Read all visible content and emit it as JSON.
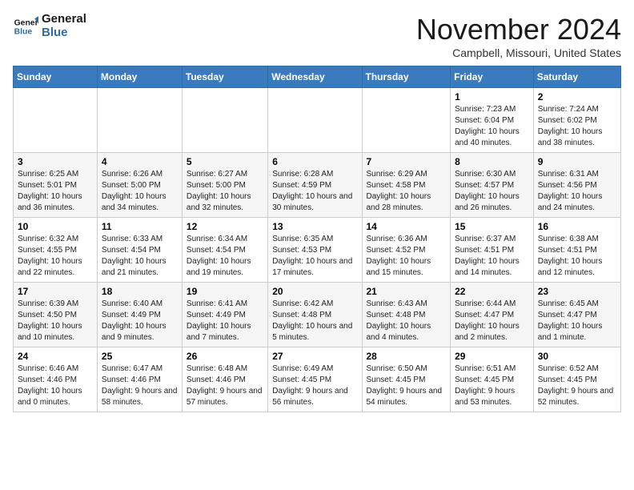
{
  "logo": {
    "line1": "General",
    "line2": "Blue"
  },
  "title": "November 2024",
  "location": "Campbell, Missouri, United States",
  "days_header": [
    "Sunday",
    "Monday",
    "Tuesday",
    "Wednesday",
    "Thursday",
    "Friday",
    "Saturday"
  ],
  "weeks": [
    [
      {
        "day": "",
        "info": ""
      },
      {
        "day": "",
        "info": ""
      },
      {
        "day": "",
        "info": ""
      },
      {
        "day": "",
        "info": ""
      },
      {
        "day": "",
        "info": ""
      },
      {
        "day": "1",
        "info": "Sunrise: 7:23 AM\nSunset: 6:04 PM\nDaylight: 10 hours and 40 minutes."
      },
      {
        "day": "2",
        "info": "Sunrise: 7:24 AM\nSunset: 6:02 PM\nDaylight: 10 hours and 38 minutes."
      }
    ],
    [
      {
        "day": "3",
        "info": "Sunrise: 6:25 AM\nSunset: 5:01 PM\nDaylight: 10 hours and 36 minutes."
      },
      {
        "day": "4",
        "info": "Sunrise: 6:26 AM\nSunset: 5:00 PM\nDaylight: 10 hours and 34 minutes."
      },
      {
        "day": "5",
        "info": "Sunrise: 6:27 AM\nSunset: 5:00 PM\nDaylight: 10 hours and 32 minutes."
      },
      {
        "day": "6",
        "info": "Sunrise: 6:28 AM\nSunset: 4:59 PM\nDaylight: 10 hours and 30 minutes."
      },
      {
        "day": "7",
        "info": "Sunrise: 6:29 AM\nSunset: 4:58 PM\nDaylight: 10 hours and 28 minutes."
      },
      {
        "day": "8",
        "info": "Sunrise: 6:30 AM\nSunset: 4:57 PM\nDaylight: 10 hours and 26 minutes."
      },
      {
        "day": "9",
        "info": "Sunrise: 6:31 AM\nSunset: 4:56 PM\nDaylight: 10 hours and 24 minutes."
      }
    ],
    [
      {
        "day": "10",
        "info": "Sunrise: 6:32 AM\nSunset: 4:55 PM\nDaylight: 10 hours and 22 minutes."
      },
      {
        "day": "11",
        "info": "Sunrise: 6:33 AM\nSunset: 4:54 PM\nDaylight: 10 hours and 21 minutes."
      },
      {
        "day": "12",
        "info": "Sunrise: 6:34 AM\nSunset: 4:54 PM\nDaylight: 10 hours and 19 minutes."
      },
      {
        "day": "13",
        "info": "Sunrise: 6:35 AM\nSunset: 4:53 PM\nDaylight: 10 hours and 17 minutes."
      },
      {
        "day": "14",
        "info": "Sunrise: 6:36 AM\nSunset: 4:52 PM\nDaylight: 10 hours and 15 minutes."
      },
      {
        "day": "15",
        "info": "Sunrise: 6:37 AM\nSunset: 4:51 PM\nDaylight: 10 hours and 14 minutes."
      },
      {
        "day": "16",
        "info": "Sunrise: 6:38 AM\nSunset: 4:51 PM\nDaylight: 10 hours and 12 minutes."
      }
    ],
    [
      {
        "day": "17",
        "info": "Sunrise: 6:39 AM\nSunset: 4:50 PM\nDaylight: 10 hours and 10 minutes."
      },
      {
        "day": "18",
        "info": "Sunrise: 6:40 AM\nSunset: 4:49 PM\nDaylight: 10 hours and 9 minutes."
      },
      {
        "day": "19",
        "info": "Sunrise: 6:41 AM\nSunset: 4:49 PM\nDaylight: 10 hours and 7 minutes."
      },
      {
        "day": "20",
        "info": "Sunrise: 6:42 AM\nSunset: 4:48 PM\nDaylight: 10 hours and 5 minutes."
      },
      {
        "day": "21",
        "info": "Sunrise: 6:43 AM\nSunset: 4:48 PM\nDaylight: 10 hours and 4 minutes."
      },
      {
        "day": "22",
        "info": "Sunrise: 6:44 AM\nSunset: 4:47 PM\nDaylight: 10 hours and 2 minutes."
      },
      {
        "day": "23",
        "info": "Sunrise: 6:45 AM\nSunset: 4:47 PM\nDaylight: 10 hours and 1 minute."
      }
    ],
    [
      {
        "day": "24",
        "info": "Sunrise: 6:46 AM\nSunset: 4:46 PM\nDaylight: 10 hours and 0 minutes."
      },
      {
        "day": "25",
        "info": "Sunrise: 6:47 AM\nSunset: 4:46 PM\nDaylight: 9 hours and 58 minutes."
      },
      {
        "day": "26",
        "info": "Sunrise: 6:48 AM\nSunset: 4:46 PM\nDaylight: 9 hours and 57 minutes."
      },
      {
        "day": "27",
        "info": "Sunrise: 6:49 AM\nSunset: 4:45 PM\nDaylight: 9 hours and 56 minutes."
      },
      {
        "day": "28",
        "info": "Sunrise: 6:50 AM\nSunset: 4:45 PM\nDaylight: 9 hours and 54 minutes."
      },
      {
        "day": "29",
        "info": "Sunrise: 6:51 AM\nSunset: 4:45 PM\nDaylight: 9 hours and 53 minutes."
      },
      {
        "day": "30",
        "info": "Sunrise: 6:52 AM\nSunset: 4:45 PM\nDaylight: 9 hours and 52 minutes."
      }
    ]
  ]
}
